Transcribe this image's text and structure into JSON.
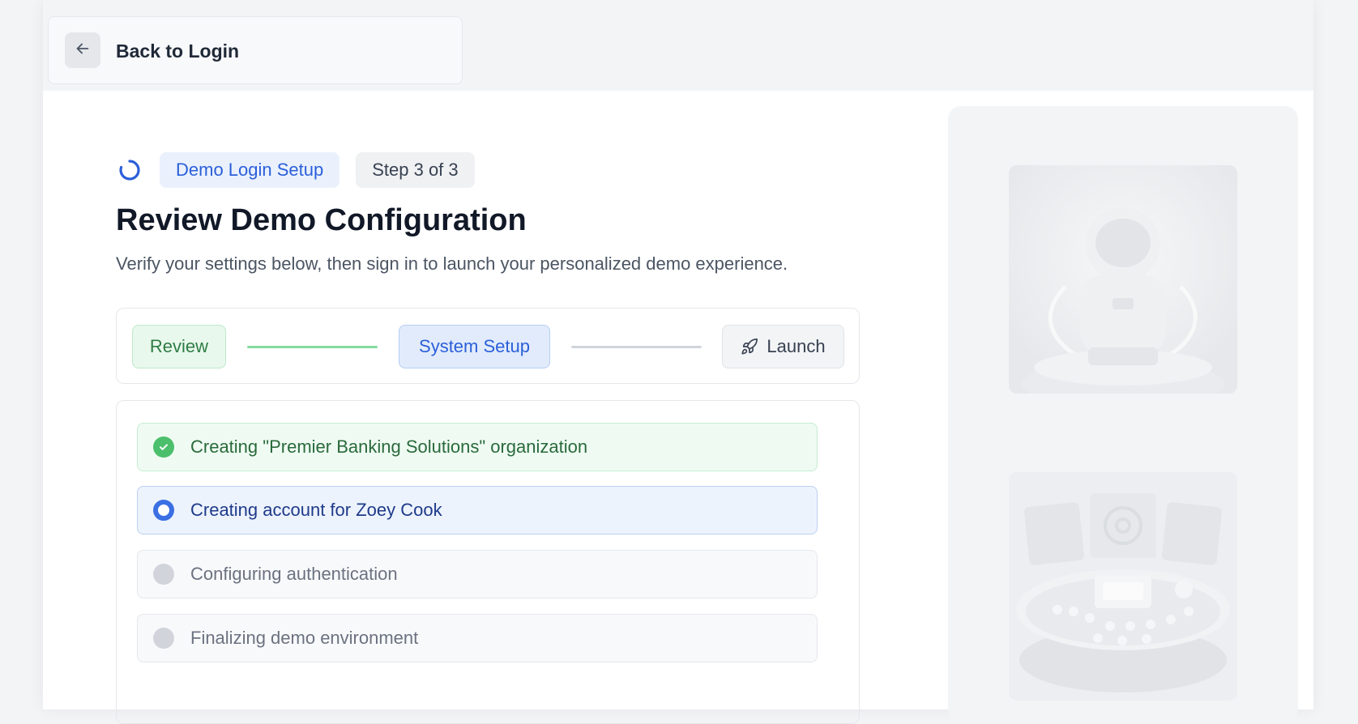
{
  "header": {
    "back_label": "Back to Login"
  },
  "badges": {
    "setup": "Demo Login Setup",
    "step": "Step 3 of 3"
  },
  "page": {
    "title": "Review Demo Configuration",
    "subtitle": "Verify your settings below, then sign in to launch your personalized demo experience."
  },
  "stepper": {
    "steps": [
      {
        "label": "Review",
        "status": "complete"
      },
      {
        "label": "System Setup",
        "status": "active"
      },
      {
        "label": "Launch",
        "status": "pending",
        "icon": "rocket-icon"
      }
    ]
  },
  "tasks": [
    {
      "label": "Creating \"Premier Banking Solutions\" organization",
      "status": "complete"
    },
    {
      "label": "Creating account for Zoey Cook",
      "status": "active"
    },
    {
      "label": "Configuring authentication",
      "status": "pending"
    },
    {
      "label": "Finalizing demo environment",
      "status": "pending"
    }
  ],
  "illustrations": [
    {
      "icon": "astronaut-illustration"
    },
    {
      "icon": "control-console-illustration"
    }
  ],
  "colors": {
    "accent_blue": "#2b5fd9",
    "success_green": "#4cbf6c",
    "background": "#f3f4f6"
  }
}
